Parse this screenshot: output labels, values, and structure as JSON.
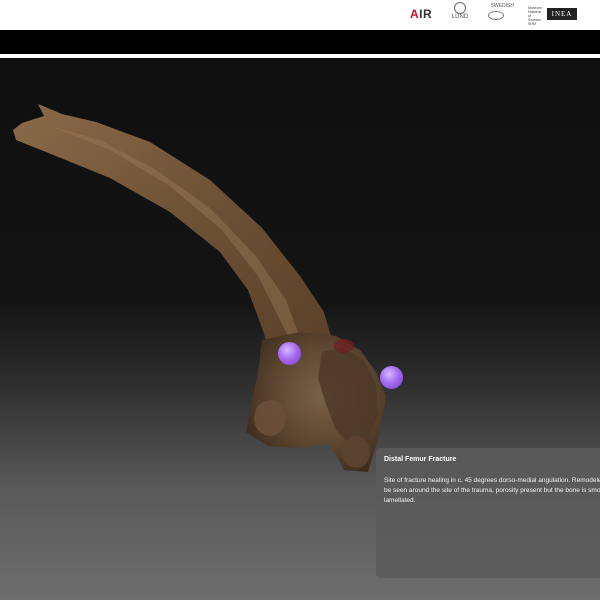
{
  "header": {
    "logos": {
      "air": "AIR",
      "lund": "LUND",
      "swedarch": "SWEDISH",
      "museum": [
        "Museum",
        "National",
        "of Sweden",
        "SHM"
      ],
      "inea": "INEA"
    }
  },
  "viewer": {
    "model_name": "Distal Femur",
    "hotspots": [
      "annotation-hotspot-1",
      "annotation-hotspot-2"
    ],
    "hotspot_color": "#a46bf0"
  },
  "info_panel": {
    "title": "Distal Femur Fracture",
    "body_lines": [
      "Site of fracture healing in c. 45 degrees dorso-medial angulation. Remodeled",
      "be seen around the site of the trauma, porosity present but the bone is smoo",
      "lamellated."
    ]
  }
}
